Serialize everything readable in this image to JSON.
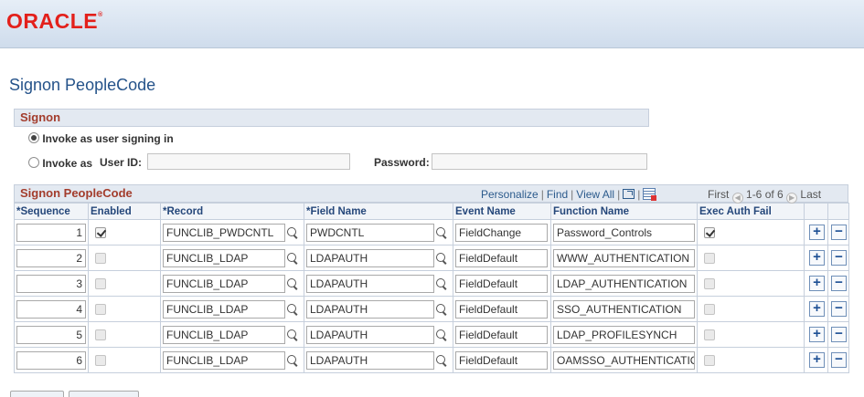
{
  "brand": {
    "logo_text": "ORACLE",
    "logo_mark": "®",
    "logo_color": "#e3201b"
  },
  "page": {
    "title": "Signon PeopleCode"
  },
  "signon": {
    "section_title": "Signon",
    "option_user_label": "Invoke as user signing in",
    "option_as_label": "Invoke as",
    "selected_option": "Invoke as user signing in",
    "user_id_label": "User ID:",
    "user_id_value": "",
    "password_label": "Password:",
    "password_value": ""
  },
  "grid": {
    "title": "Signon PeopleCode",
    "toolbar": {
      "personalize": "Personalize",
      "find": "Find",
      "view_all": "View All"
    },
    "nav": {
      "first": "First",
      "range": "1-6 of 6",
      "last": "Last"
    },
    "columns": [
      "*Sequence",
      "Enabled",
      "*Record",
      "*Field Name",
      "Event Name",
      "Function Name",
      "Exec Auth Fail"
    ],
    "rows": [
      {
        "seq": "1",
        "enabled": true,
        "record": "FUNCLIB_PWDCNTL",
        "field": "PWDCNTL",
        "event": "FieldChange",
        "function": "Password_Controls",
        "exec_auth_fail": true
      },
      {
        "seq": "2",
        "enabled": false,
        "record": "FUNCLIB_LDAP",
        "field": "LDAPAUTH",
        "event": "FieldDefault",
        "function": "WWW_AUTHENTICATION",
        "exec_auth_fail": false
      },
      {
        "seq": "3",
        "enabled": false,
        "record": "FUNCLIB_LDAP",
        "field": "LDAPAUTH",
        "event": "FieldDefault",
        "function": "LDAP_AUTHENTICATION",
        "exec_auth_fail": false
      },
      {
        "seq": "4",
        "enabled": false,
        "record": "FUNCLIB_LDAP",
        "field": "LDAPAUTH",
        "event": "FieldDefault",
        "function": "SSO_AUTHENTICATION",
        "exec_auth_fail": false
      },
      {
        "seq": "5",
        "enabled": false,
        "record": "FUNCLIB_LDAP",
        "field": "LDAPAUTH",
        "event": "FieldDefault",
        "function": "LDAP_PROFILESYNCH",
        "exec_auth_fail": false
      },
      {
        "seq": "6",
        "enabled": false,
        "record": "FUNCLIB_LDAP",
        "field": "LDAPAUTH",
        "event": "FieldDefault",
        "function": "OAMSSO_AUTHENTICATIO",
        "exec_auth_fail": false
      }
    ],
    "row_buttons": {
      "add": "+",
      "delete": "−"
    }
  },
  "icons": [
    "search-icon",
    "zoom-icon",
    "excel-icon",
    "prev-arrow-icon",
    "next-arrow-icon",
    "add-row-icon",
    "delete-row-icon",
    "radio-icon",
    "checkbox-icon"
  ]
}
